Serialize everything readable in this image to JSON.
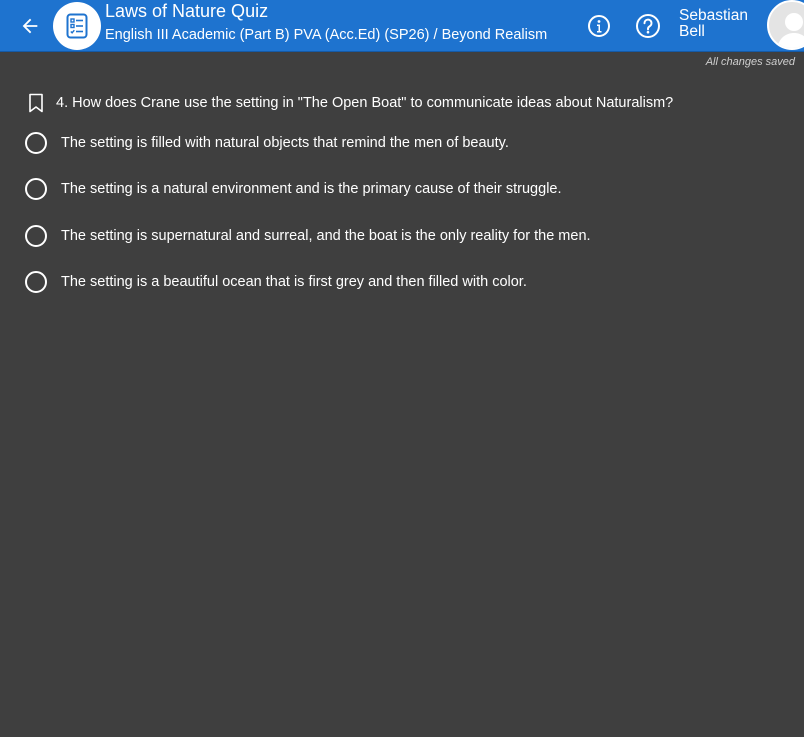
{
  "header": {
    "title": "Laws of Nature Quiz",
    "subtitle": "English III Academic (Part B) PVA (Acc.Ed) (SP26) / Beyond Realism",
    "user_name": "Sebastian Bell",
    "icons": {
      "back": "arrow-left-icon",
      "quiz": "checklist-icon",
      "info": "info-icon",
      "help": "help-icon",
      "avatar": "user-avatar"
    },
    "accent_color": "#1e73cf"
  },
  "status": {
    "saved": "All changes saved"
  },
  "question": {
    "number": "4",
    "text": "4. How does Crane use the setting in \"The Open Boat\" to communicate ideas about Naturalism?",
    "options": [
      {
        "label": "The setting is filled with natural objects that remind the men of beauty."
      },
      {
        "label": "The setting is a natural environment and is the primary cause of their struggle."
      },
      {
        "label": "The setting is supernatural and surreal, and the boat is the only reality for the men."
      },
      {
        "label": "The setting is a beautiful ocean that is first grey and then filled with color."
      }
    ]
  }
}
